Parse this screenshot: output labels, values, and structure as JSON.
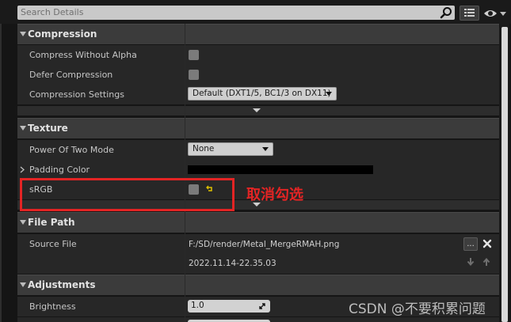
{
  "search": {
    "placeholder": "Search Details"
  },
  "categories": {
    "compression": "Compression",
    "texture": "Texture",
    "file_path": "File Path",
    "adjustments": "Adjustments"
  },
  "compression": {
    "compress_without_alpha": {
      "label": "Compress Without Alpha",
      "checked": false
    },
    "defer_compression": {
      "label": "Defer Compression",
      "checked": false
    },
    "compression_settings": {
      "label": "Compression Settings",
      "value": "Default (DXT1/5, BC1/3 on DX11)"
    }
  },
  "texture": {
    "power_of_two_mode": {
      "label": "Power Of Two Mode",
      "value": "None"
    },
    "padding_color": {
      "label": "Padding Color",
      "color": "#000000"
    },
    "srgb": {
      "label": "sRGB",
      "checked": false
    }
  },
  "file_path": {
    "source_file": {
      "label": "Source File",
      "path": "F:/SD/render/Metal_MergeRMAH.png",
      "timestamp": "2022.11.14-22.35.03",
      "browse_label": "..."
    }
  },
  "adjustments": {
    "brightness": {
      "label": "Brightness",
      "value": "1.0"
    }
  },
  "annotation": {
    "text": "取消勾选",
    "color": "#e32424"
  },
  "watermark": {
    "text": "CSDN @不要积累问题"
  }
}
